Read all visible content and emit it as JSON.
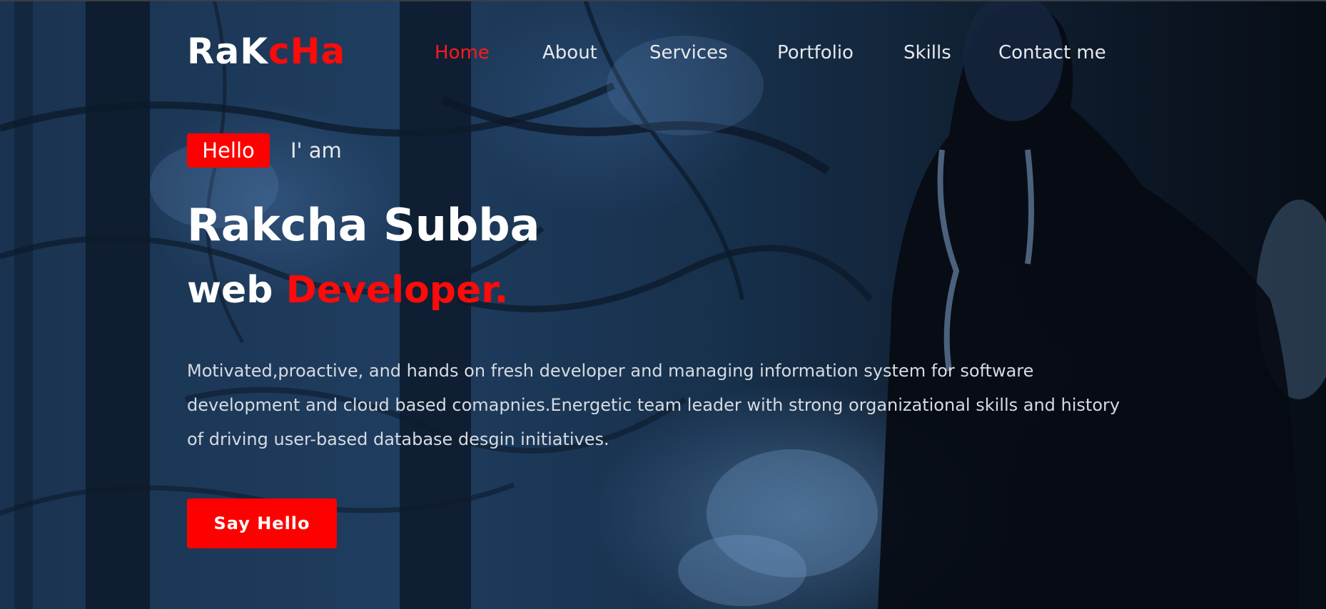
{
  "header": {
    "logo_prefix": "RaK",
    "logo_accent": "cHa",
    "nav": [
      {
        "label": "Home",
        "active": true
      },
      {
        "label": "About",
        "active": false
      },
      {
        "label": "Services",
        "active": false
      },
      {
        "label": "Portfolio",
        "active": false
      },
      {
        "label": "Skills",
        "active": false
      },
      {
        "label": "Contact me",
        "active": false
      }
    ]
  },
  "intro": {
    "badge": "Hello",
    "greeting": "I' am",
    "name": "Rakcha Subba",
    "role_prefix": "web ",
    "role_accent": "Developer.",
    "bio": "Motivated,proactive, and hands on fresh developer and managing information system for software development and cloud based comapnies.Energetic team leader with strong organizational skills and history of driving user-based database desgin initiatives.",
    "cta_label": "Say Hello"
  },
  "colors": {
    "accent": "#ff0000",
    "text": "#ffffff",
    "overlay": "#1f3d5f"
  }
}
